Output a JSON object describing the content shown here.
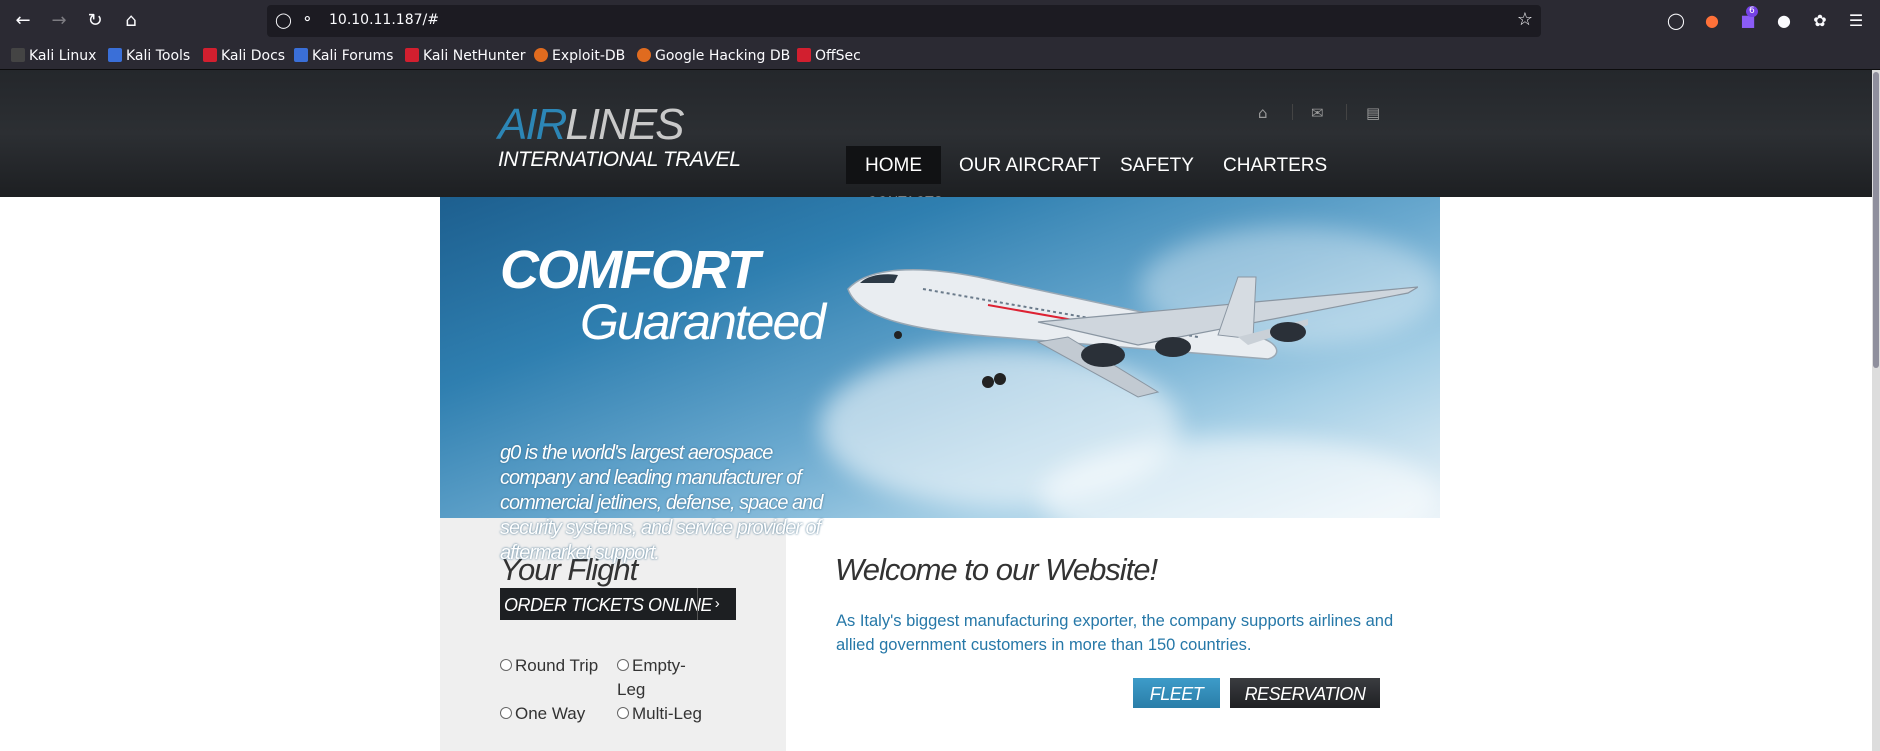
{
  "browser": {
    "url": "10.10.11.187/#",
    "bookmarks": [
      {
        "label": "Kali Linux",
        "color": "#1a1a1a"
      },
      {
        "label": "Kali Tools",
        "color": "#3a6fd8"
      },
      {
        "label": "Kali Docs",
        "color": "#d21f2f"
      },
      {
        "label": "Kali Forums",
        "color": "#3a6fd8"
      },
      {
        "label": "Kali NetHunter",
        "color": "#d21f2f"
      },
      {
        "label": "Exploit-DB",
        "color": "#e06b1f"
      },
      {
        "label": "Google Hacking DB",
        "color": "#e06b1f"
      },
      {
        "label": "OffSec",
        "color": "#d21f2f"
      }
    ],
    "extension_badge": "6"
  },
  "site": {
    "logo": {
      "air": "AIR",
      "lines": "LINES",
      "sub": "INTERNATIONAL TRAVEL"
    },
    "menu": [
      "HOME",
      "OUR AIRCRAFT",
      "SAFETY",
      "CHARTERS"
    ],
    "menu_overflow": "CONTACTS",
    "hero": {
      "title": "COMFORT",
      "subtitle": "Guaranteed",
      "text": "g0 is the world's largest aerospace company and leading manufacturer of commercial jetliners, defense, space and security systems, and service provider of aftermarket support."
    },
    "planner": {
      "title": "Your Flight Planner",
      "order_button": "ORDER TICKETS ONLINE",
      "options": [
        "Round Trip",
        "Empty-Leg",
        "One Way",
        "Multi-Leg"
      ]
    },
    "welcome": {
      "title": "Welcome to our Website!",
      "text": "As Italy's biggest manufacturing exporter, the company supports airlines and allied government customers in more than 150 countries.",
      "fleet_button": "FLEET",
      "reservation_button": "RESERVATION"
    },
    "colors": {
      "accent": "#2c86b6",
      "header_bg": "#2c2f33",
      "link_text": "#2678a8"
    }
  }
}
